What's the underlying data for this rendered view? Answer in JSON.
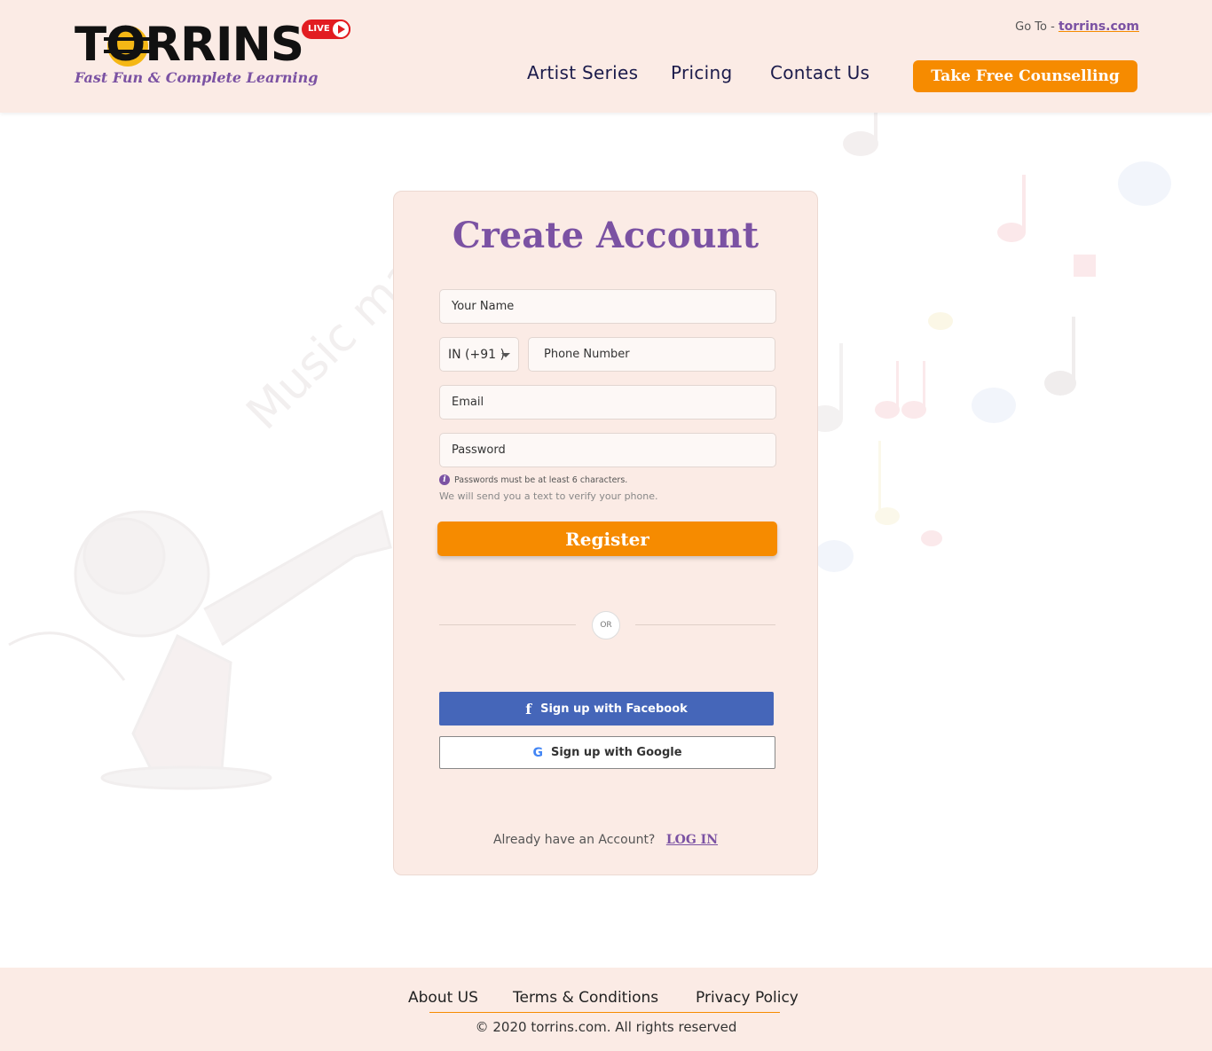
{
  "header": {
    "logo_text": "TORRINS",
    "tagline": "Fast Fun & Complete Learning",
    "live_badge": "LIVE",
    "goto_prefix": "Go To -",
    "goto_link": "torrins.com",
    "nav": {
      "artist_series": "Artist Series",
      "pricing": "Pricing",
      "contact_us": "Contact Us"
    },
    "cta_label": "Take Free Counselling"
  },
  "form": {
    "title": "Create Account",
    "name_placeholder": "Your Name",
    "country_code": "IN (+91 )",
    "phone_placeholder": "Phone Number",
    "email_placeholder": "Email",
    "password_placeholder": "Password",
    "password_hint": "Passwords must be at least 6 characters.",
    "verify_note": "We will send you a text to verify your phone.",
    "register_label": "Register",
    "or_label": "OR",
    "facebook_label": "Sign up with Facebook",
    "google_label": "Sign up with Google",
    "login_prompt": "Already have an Account?",
    "login_link": "LOG IN"
  },
  "background": {
    "watermark_text": "Music ma"
  },
  "footer": {
    "about": "About US",
    "terms": "Terms & Conditions",
    "privacy": "Privacy Policy",
    "copyright": "2020 torrins.com. All rights reserved"
  },
  "colors": {
    "header_bg": "#fbebe5",
    "accent_orange": "#f68b00",
    "brand_purple": "#7b52a3",
    "nav_text": "#1b1b4b",
    "facebook_blue": "#4566b9",
    "live_red": "#e21c21"
  }
}
